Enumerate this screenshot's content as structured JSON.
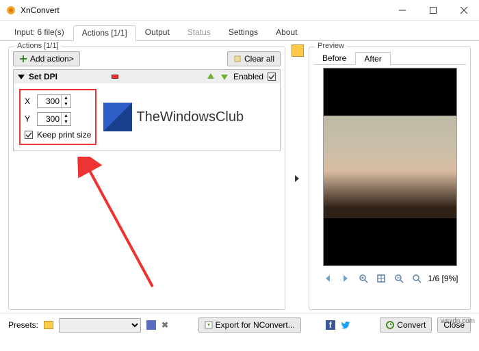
{
  "window": {
    "title": "XnConvert"
  },
  "tabs": {
    "input": "Input: 6 file(s)",
    "actions": "Actions [1/1]",
    "output": "Output",
    "status": "Status",
    "settings": "Settings",
    "about": "About"
  },
  "actions_panel": {
    "legend": "Actions [1/1]",
    "add_action": "Add action>",
    "clear_all": "Clear all",
    "item": {
      "name": "Set DPI",
      "enabled_label": "Enabled",
      "x_label": "X",
      "x_value": "300",
      "y_label": "Y",
      "y_value": "300",
      "keep_print": "Keep print size"
    }
  },
  "watermark_text": "TheWindowsClub",
  "preview": {
    "legend": "Preview",
    "before": "Before",
    "after": "After",
    "counter": "1/6 [9%]"
  },
  "bottom": {
    "presets_label": "Presets:",
    "export": "Export for NConvert...",
    "convert": "Convert",
    "close": "Close"
  },
  "source_watermark": "wsxdn.com"
}
